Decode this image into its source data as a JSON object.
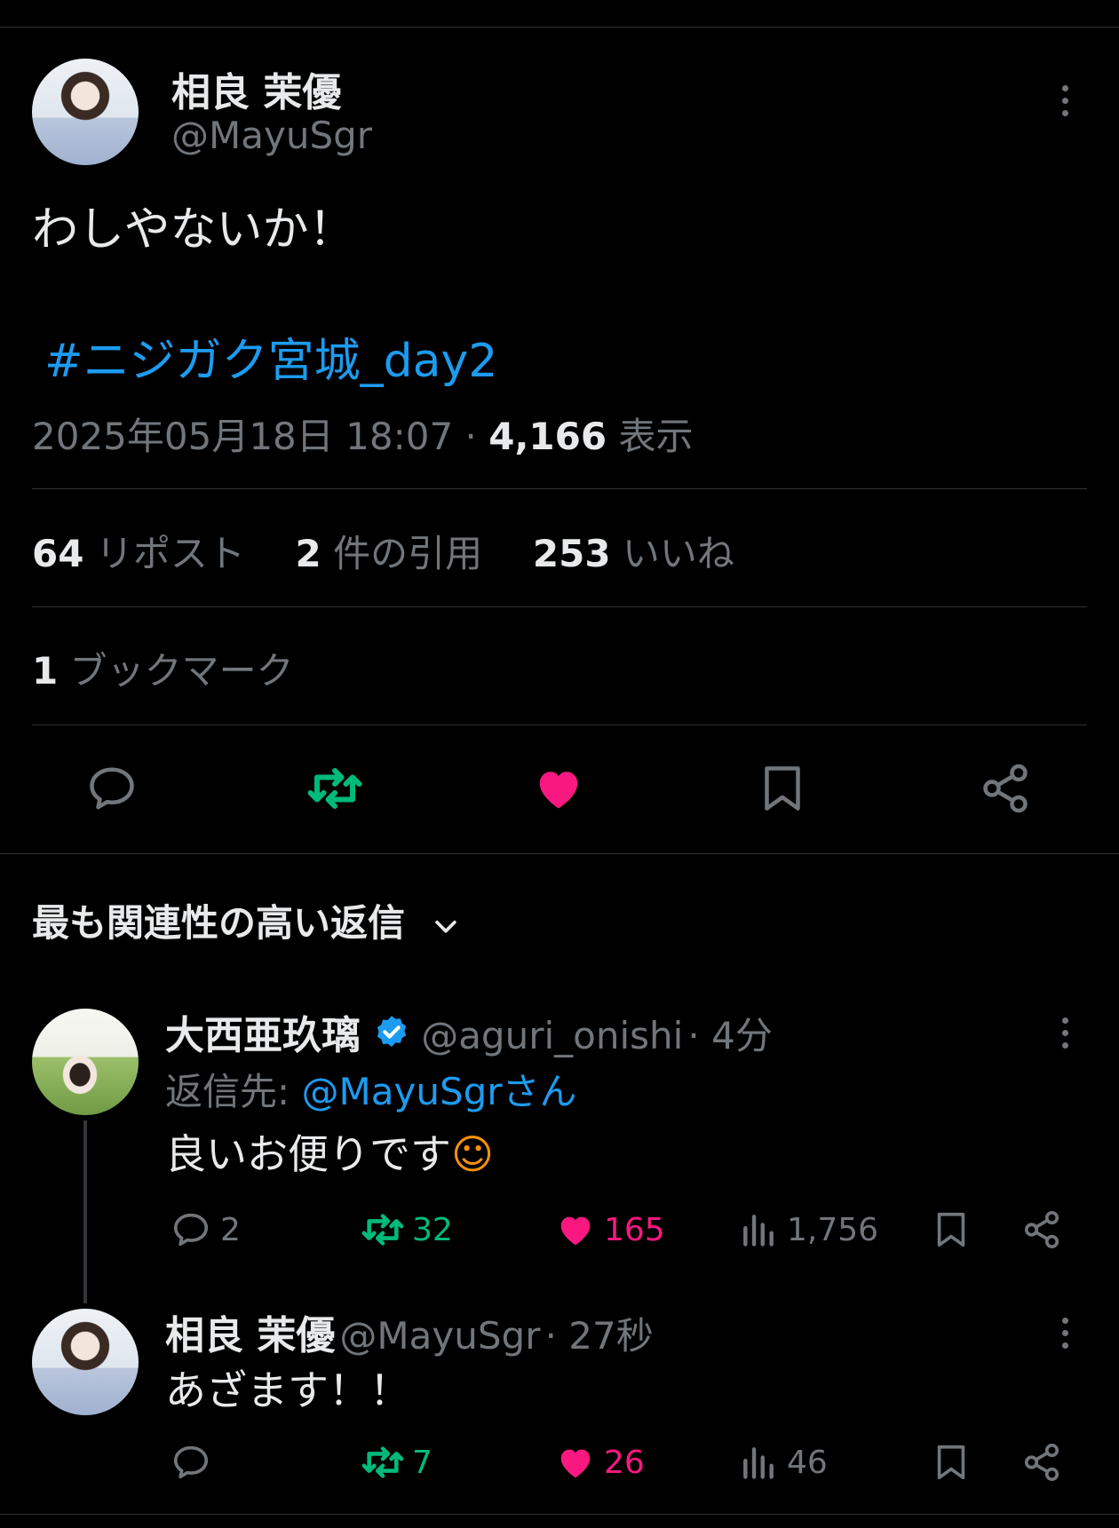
{
  "main_tweet": {
    "display_name": "相良 茉優",
    "handle": "@MayuSgr",
    "text": "わしやないか！",
    "hashtag": "#ニジガク宮城_day2",
    "timestamp": "2025年05月18日 18:07",
    "separator": "·",
    "views_count": "4,166",
    "views_label": "表示",
    "reposts_count": "64",
    "reposts_label": "リポスト",
    "quotes_count": "2",
    "quotes_label": "件の引用",
    "likes_count": "253",
    "likes_label": "いいね",
    "bookmarks_count": "1",
    "bookmarks_label": "ブックマーク",
    "liked": true,
    "reposted": true
  },
  "replies_sort": {
    "label": "最も関連性の高い返信"
  },
  "replies": [
    {
      "display_name": "大西亜玖璃",
      "verified": true,
      "handle": "@aguri_onishi",
      "time": "· 4分",
      "reply_to_prefix": "返信先: ",
      "reply_to": "@MayuSgrさん",
      "text": "良いお便りです",
      "emoji": "☺",
      "reply_count": "2",
      "repost_count": "32",
      "like_count": "165",
      "view_count": "1,756"
    },
    {
      "display_name": "相良 茉優",
      "verified": false,
      "handle": "@MayuSgr",
      "time": "· 27秒",
      "text": "あざます！！",
      "reply_count": "",
      "repost_count": "7",
      "like_count": "26",
      "view_count": "46"
    }
  ],
  "colors": {
    "background": "#000000",
    "text": "#e7e9ea",
    "secondary": "#71767b",
    "link": "#1d9bf0",
    "repost": "#00ba7c",
    "like": "#f91880",
    "divider": "#2f3336",
    "emoji": "#f4900c"
  }
}
